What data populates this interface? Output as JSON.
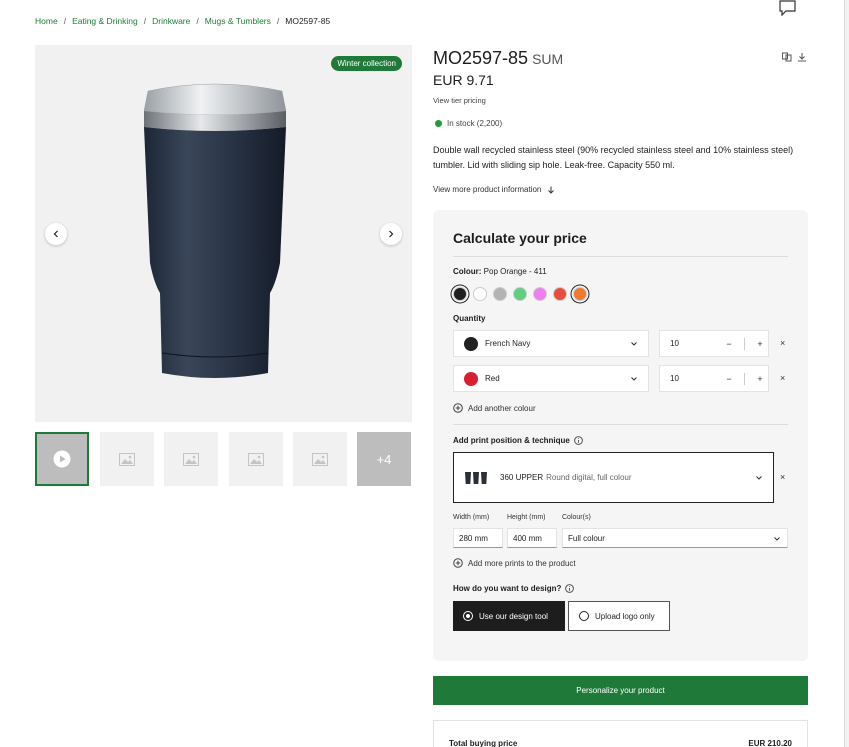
{
  "breadcrumb": {
    "items": [
      "Home",
      "Eating & Drinking",
      "Drinkware",
      "Mugs & Tumblers"
    ],
    "current": "MO2597-85"
  },
  "gallery": {
    "badge": "Winter collection",
    "more_count": "+4"
  },
  "product": {
    "code": "MO2597-85",
    "name": "SUM",
    "price": "EUR 9.71",
    "tier_link": "View tier pricing",
    "stock": "In stock (2,200)",
    "description": "Double wall recycled stainless steel (90% recycled stainless steel and 10% stainless steel) tumbler. Lid with sliding sip hole. Leak-free. Capacity 550 ml.",
    "more_info": "View more product information"
  },
  "calculator": {
    "title": "Calculate your price",
    "colour_label": "Colour:",
    "colour_value": "Pop Orange - 411",
    "swatches": [
      "#1d1d1d",
      "#ffffff",
      "#b3b3b3",
      "#5fcf80",
      "#ef7ef0",
      "#e94b3c",
      "#f07a2e"
    ],
    "quantity_label": "Quantity",
    "rows": [
      {
        "colour": "French Navy",
        "dot": "#222222",
        "qty": "10"
      },
      {
        "colour": "Red",
        "dot": "#d6202f",
        "qty": "10"
      }
    ],
    "minus": "−",
    "plus": "+",
    "remove": "×",
    "add_colour": "Add another colour",
    "print_label": "Add print position & technique",
    "print_position": "360 UPPER",
    "print_technique": "Round digital, full colour",
    "width_label": "Width (mm)",
    "width_value": "280 mm",
    "height_label": "Height (mm)",
    "height_value": "400 mm",
    "colours_label": "Colour(s)",
    "colours_value": "Full colour",
    "add_prints": "Add more prints to the product",
    "design_label": "How do you want to design?",
    "design_tool": "Use our design tool",
    "upload_logo": "Upload logo only"
  },
  "personalize": "Personalize your product",
  "total": {
    "label": "Total buying price",
    "amount": "EUR 210.20"
  }
}
